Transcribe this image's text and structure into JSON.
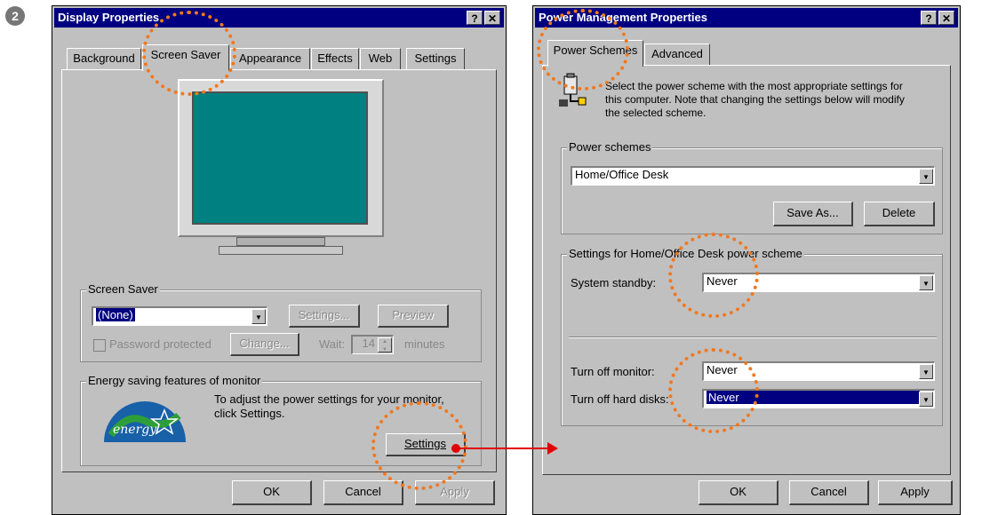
{
  "step_number": "2",
  "display_properties": {
    "title": "Display Properties",
    "help_button": "?",
    "close_button": "✕",
    "tabs": [
      "Background",
      "Screen Saver",
      "Appearance",
      "Effects",
      "Web",
      "Settings"
    ],
    "selected_tab": "Screen Saver",
    "screen_saver": {
      "group_label": "Screen Saver",
      "selected": "(None)",
      "settings_button": "Settings...",
      "preview_button": "Preview",
      "password_label": "Password protected",
      "change_button": "Change...",
      "wait_label": "Wait:",
      "wait_value": "14",
      "minutes_label": "minutes"
    },
    "energy": {
      "group_label": "Energy saving features of monitor",
      "logo_text": "energy",
      "description_line1": "To adjust the power settings for your monitor,",
      "description_line2": "click Settings.",
      "settings_button": "Settings"
    },
    "ok_button": "OK",
    "cancel_button": "Cancel",
    "apply_button": "Apply"
  },
  "power_management": {
    "title": "Power Management Properties",
    "help_button": "?",
    "close_button": "✕",
    "tabs": [
      "Power Schemes",
      "Advanced"
    ],
    "selected_tab": "Power Schemes",
    "description_line1": "Select the power scheme with the most appropriate settings for",
    "description_line2": "this computer. Note that changing the settings below will modify",
    "description_line3": "the selected scheme.",
    "power_schemes_label": "Power schemes",
    "scheme_value": "Home/Office Desk",
    "save_as_button": "Save As...",
    "delete_button": "Delete",
    "settings_group_label": "Settings for Home/Office Desk power scheme",
    "system_standby_label": "System standby:",
    "system_standby_value": "Never",
    "turn_off_monitor_label": "Turn off monitor:",
    "turn_off_monitor_value": "Never",
    "turn_off_hard_disks_label": "Turn off hard disks:",
    "turn_off_hard_disks_value": "Never",
    "ok_button": "OK",
    "cancel_button": "Cancel",
    "apply_button": "Apply"
  },
  "colors": {
    "titlebar": "#000080",
    "dialog_face": "#c0c0c0",
    "highlight_circle": "#f07820",
    "arrow": "#e00000",
    "monitor_screen": "#008080"
  }
}
